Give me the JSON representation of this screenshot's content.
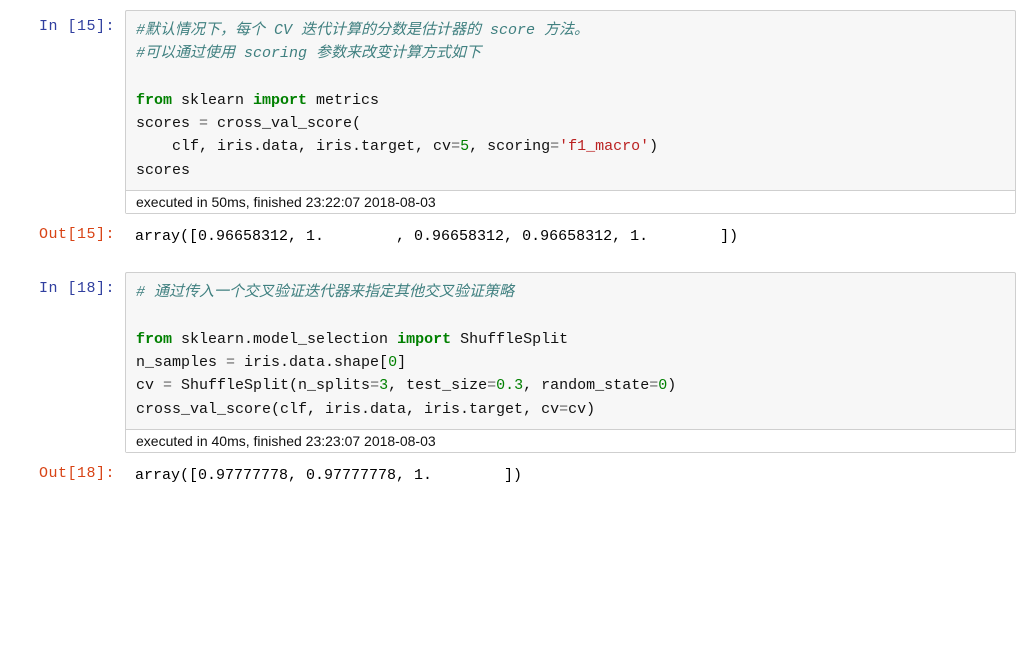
{
  "cells": {
    "c15": {
      "in_prompt": "In  [15]:",
      "out_prompt": "Out[15]:",
      "code": {
        "comment1": "#默认情况下，每个 CV 迭代计算的分数是估计器的 score 方法。",
        "comment2": "#可以通过使用 scoring 参数来改变计算方式如下",
        "kw_from": "from",
        "mod1": " sklearn ",
        "kw_import": "import",
        "mod2": " metrics",
        "line3a": "scores ",
        "op_eq": "=",
        "line3b": " cross_val_score(",
        "line4a": "    clf, iris.data, iris.target, cv",
        "num5": "5",
        "line4b": ", scoring",
        "str_f1": "'f1_macro'",
        "line4c": ")",
        "line5": "scores"
      },
      "exec": "executed in 50ms, finished 23:22:07 2018-08-03",
      "output": "array([0.96658312, 1.        , 0.96658312, 0.96658312, 1.        ])"
    },
    "c18": {
      "in_prompt": "In  [18]:",
      "out_prompt": "Out[18]:",
      "code": {
        "comment1": "# 通过传入一个交叉验证迭代器来指定其他交叉验证策略",
        "kw_from": "from",
        "mod1": " sklearn.model_selection ",
        "kw_import": "import",
        "mod2": " ShuffleSplit",
        "line2a": "n_samples ",
        "op_eq": "=",
        "line2b": " iris.data.shape[",
        "num0": "0",
        "line2c": "]",
        "line3a": "cv ",
        "line3b": " ShuffleSplit(n_splits",
        "num3": "3",
        "line3c": ", test_size",
        "num03": "0.3",
        "line3d": ", random_state",
        "num0b": "0",
        "line3e": ")",
        "line4a": "cross_val_score(clf, iris.data, iris.target, cv",
        "line4b": "cv)"
      },
      "exec": "executed in 40ms, finished 23:23:07 2018-08-03",
      "output": "array([0.97777778, 0.97777778, 1.        ])"
    }
  }
}
